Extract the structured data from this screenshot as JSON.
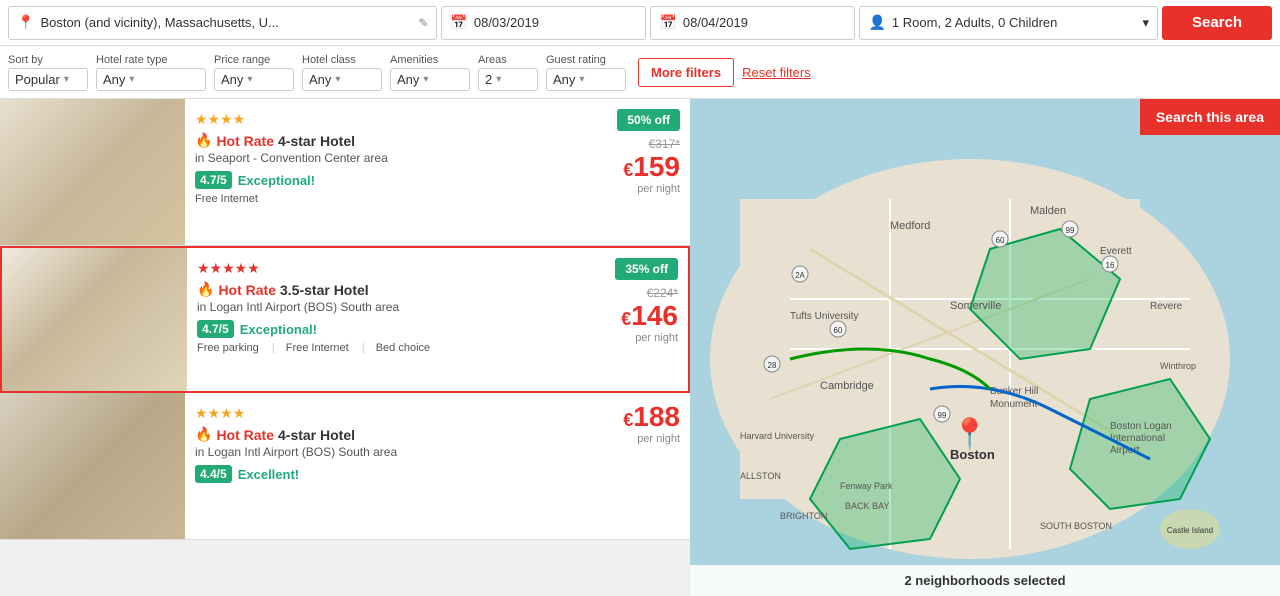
{
  "search_bar": {
    "location": "Boston (and vicinity), Massachusetts, U...",
    "date_in": "08/03/2019",
    "date_out": "08/04/2019",
    "rooms": "1 Room, 2 Adults, 0 Children",
    "search_btn": "Search"
  },
  "filters": {
    "sort_by_label": "Sort by",
    "sort_by_value": "Popular",
    "hotel_rate_label": "Hotel rate type",
    "hotel_rate_value": "Any",
    "price_range_label": "Price range",
    "price_range_value": "Any",
    "hotel_class_label": "Hotel class",
    "hotel_class_value": "Any",
    "amenities_label": "Amenities",
    "amenities_value": "Any",
    "areas_label": "Areas",
    "areas_value": "2",
    "guest_rating_label": "Guest rating",
    "guest_rating_value": "Any",
    "more_filters": "More filters",
    "reset_filters": "Reset filters"
  },
  "hotels": [
    {
      "stars": 4,
      "hot_label": "Hot Rate",
      "name": "4-star Hotel",
      "area": "in Seaport - Convention Center area",
      "rating": "4.7/5",
      "rating_text": "Exceptional!",
      "amenities": "Free Internet",
      "discount": "50% off",
      "original_price": "€317*",
      "price": "159",
      "currency": "€",
      "per_night": "per night",
      "selected": false,
      "img_class": "img-1"
    },
    {
      "stars": 5,
      "hot_label": "Hot Rate",
      "name": "3.5-star Hotel",
      "area": "in Logan Intl Airport (BOS) South area",
      "rating": "4.7/5",
      "rating_text": "Exceptional!",
      "amenities": "Free parking | Free Internet | Bed choice",
      "discount": "35% off",
      "original_price": "€224*",
      "price": "146",
      "currency": "€",
      "per_night": "per night",
      "selected": true,
      "img_class": "img-2"
    },
    {
      "stars": 4,
      "hot_label": "Hot Rate",
      "name": "4-star Hotel",
      "area": "in Logan Intl Airport (BOS) South area",
      "rating": "4.4/5",
      "rating_text": "Excellent!",
      "amenities": "",
      "discount": "",
      "original_price": "",
      "price": "188",
      "currency": "€",
      "per_night": "per night",
      "selected": false,
      "img_class": "img-3"
    }
  ],
  "map": {
    "search_area_btn": "Search this area",
    "neighborhoods_text": "2 neighborhoods selected"
  }
}
